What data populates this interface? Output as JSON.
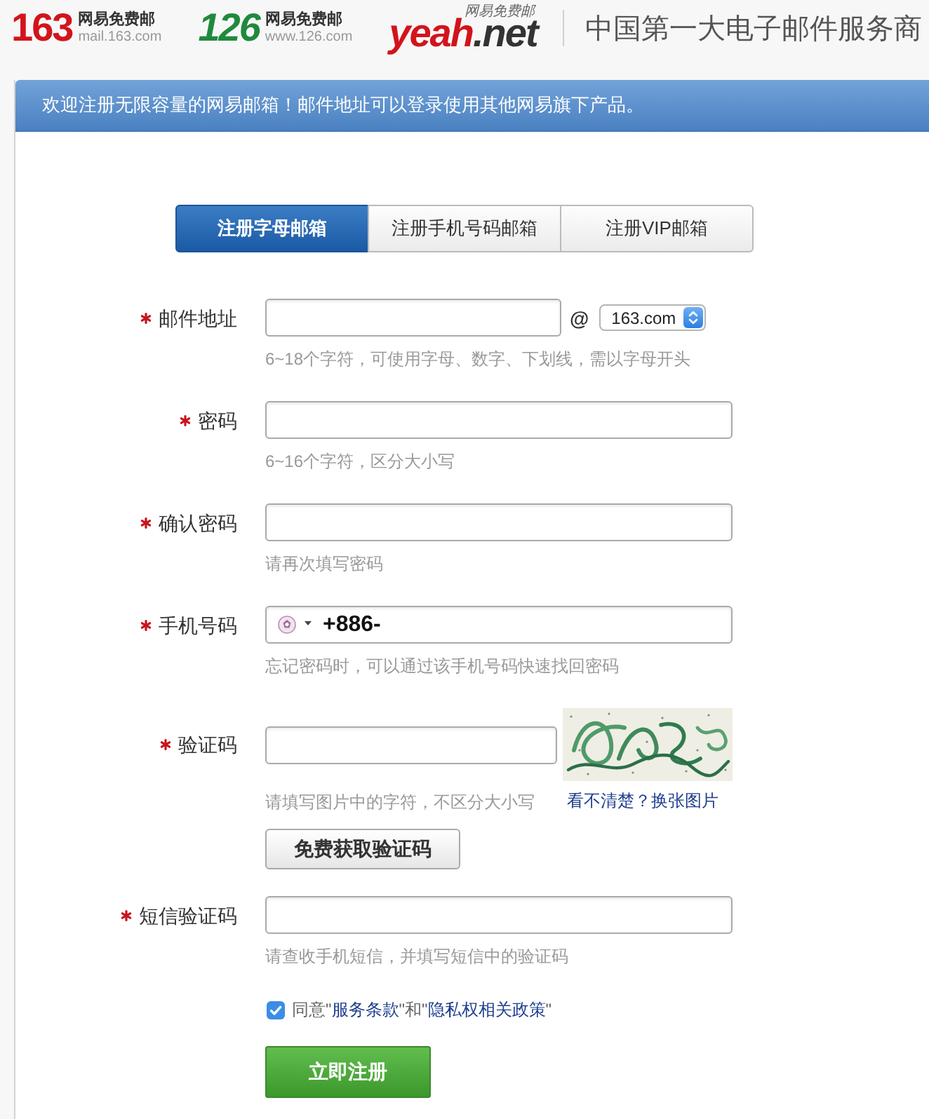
{
  "header": {
    "logos": [
      {
        "kind": "plain",
        "color": "#d2141c",
        "wordmark": "163",
        "tagline": "网易免费邮",
        "domain": "mail.163.com"
      },
      {
        "kind": "slanted",
        "color": "#1f8a3c",
        "wordmark": "126",
        "tagline": "网易免费邮",
        "domain": "www.126.com"
      },
      {
        "kind": "split",
        "color": "#d2141c",
        "wordmark": "yeah",
        "suffix": ".net",
        "tagline": "网易免费邮"
      }
    ],
    "slogan": "中国第一大电子邮件服务商"
  },
  "banner": {
    "text": "欢迎注册无限容量的网易邮箱！邮件地址可以登录使用其他网易旗下产品。"
  },
  "tabs": [
    {
      "label": "注册字母邮箱",
      "selected": true
    },
    {
      "label": "注册手机号码邮箱",
      "selected": false
    },
    {
      "label": "注册VIP邮箱",
      "selected": false
    }
  ],
  "fields": [
    {
      "kind": "email",
      "label": "邮件地址",
      "required": true,
      "at": "@",
      "domain": "163.com",
      "hint": "6~18个字符，可使用字母、数字、下划线，需以字母开头"
    },
    {
      "kind": "password",
      "label": "密码",
      "required": true,
      "hint": "6~16个字符，区分大小写"
    },
    {
      "kind": "password-confirm",
      "label": "确认密码",
      "required": true,
      "hint": "请再次填写密码"
    },
    {
      "kind": "phone",
      "label": "手机号码",
      "required": true,
      "value": "+886-",
      "hint": "忘记密码时，可以通过该手机号码快速找回密码"
    },
    {
      "kind": "captcha",
      "label": "验证码",
      "required": true,
      "hint": "请填写图片中的字符，不区分大小写",
      "refresh_link": "看不清楚？换张图片",
      "button": "免费获取验证码"
    },
    {
      "kind": "sms-code",
      "label": "短信验证码",
      "required": true,
      "hint": "请查收手机短信，并填写短信中的验证码"
    }
  ],
  "agreement": {
    "checked": true,
    "parts": [
      {
        "kind": "text",
        "text": "同意\""
      },
      {
        "kind": "link",
        "text": "服务条款"
      },
      {
        "kind": "text",
        "text": "\"和\""
      },
      {
        "kind": "link",
        "text": "隐私权相关政策"
      },
      {
        "kind": "text",
        "text": "\""
      }
    ]
  },
  "submit": {
    "label": "立即注册"
  }
}
